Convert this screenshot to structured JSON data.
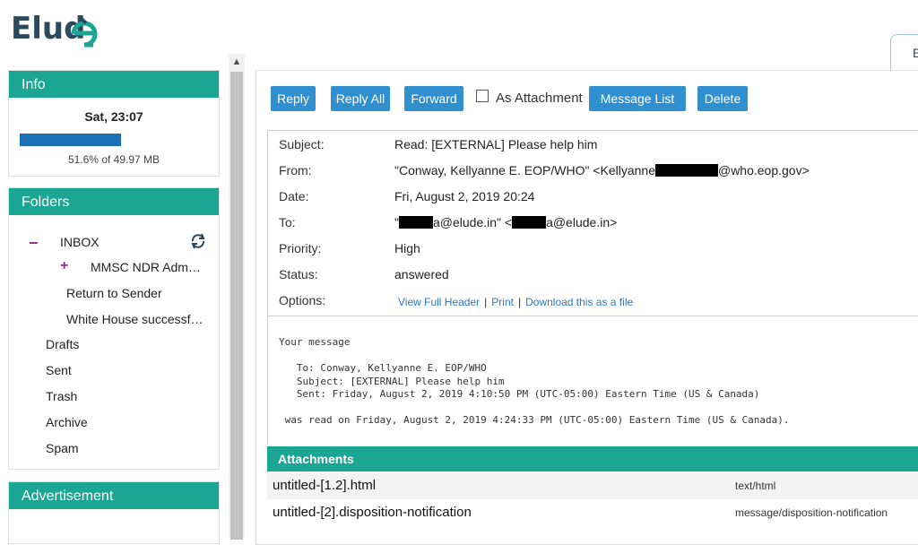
{
  "brand": {
    "logo_text": "Elud",
    "logo_e": "e"
  },
  "top_tab": {
    "label": "E"
  },
  "info_panel": {
    "title": "Info",
    "datetime": "Sat, 23:07",
    "quota_fraction": 0.516,
    "quota_text": "51.6% of 49.97 MB"
  },
  "folders_panel": {
    "title": "Folders",
    "inbox": "INBOX",
    "subfolder_1": "MMSC NDR Adm…",
    "subfolder_2": "Return to Sender",
    "subfolder_3": "White House successf…",
    "drafts": "Drafts",
    "sent": "Sent",
    "trash": "Trash",
    "archive": "Archive",
    "spam": "Spam"
  },
  "ads_panel": {
    "title": "Advertisement"
  },
  "toolbar": {
    "reply": "Reply",
    "reply_all": "Reply All",
    "forward": "Forward",
    "as_attachment": "As Attachment",
    "message_list": "Message List",
    "delete": "Delete"
  },
  "message": {
    "subject_label": "Subject:",
    "subject": "Read: [EXTERNAL] Please help him",
    "from_label": "From:",
    "from_prefix": "\"Conway, Kellyanne E. EOP/WHO\" <Kellyanne",
    "from_suffix": "@who.eop.gov>",
    "date_label": "Date:",
    "date": "Fri, August 2, 2019 20:24",
    "to_label": "To:",
    "to_part1": "\"",
    "to_part2": "a@elude.in\" <",
    "to_part3": "a@elude.in>",
    "priority_label": "Priority:",
    "priority": "High",
    "status_label": "Status:",
    "status": "answered",
    "options_label": "Options:",
    "option_full_header": "View Full Header",
    "option_print": "Print",
    "option_download": "Download this as a file",
    "separator": "|"
  },
  "body_text": "Your message\n\n   To: Conway, Kellyanne E. EOP/WHO\n   Subject: [EXTERNAL] Please help him\n   Sent: Friday, August 2, 2019 4:10:50 PM (UTC-05:00) Eastern Time (US & Canada)\n\n was read on Friday, August 2, 2019 4:24:33 PM (UTC-05:00) Eastern Time (US & Canada).",
  "attachments": {
    "title": "Attachments",
    "items": [
      {
        "name": "untitled-[1.2].html",
        "type": "text/html"
      },
      {
        "name": "untitled-[2].disposition-notification",
        "type": "message/disposition-notification"
      }
    ]
  },
  "colors": {
    "teal": "#1aa692",
    "button_blue": "#2f8fcf",
    "link_blue": "#2b78c2",
    "quota_blue": "#1b6fb5"
  }
}
